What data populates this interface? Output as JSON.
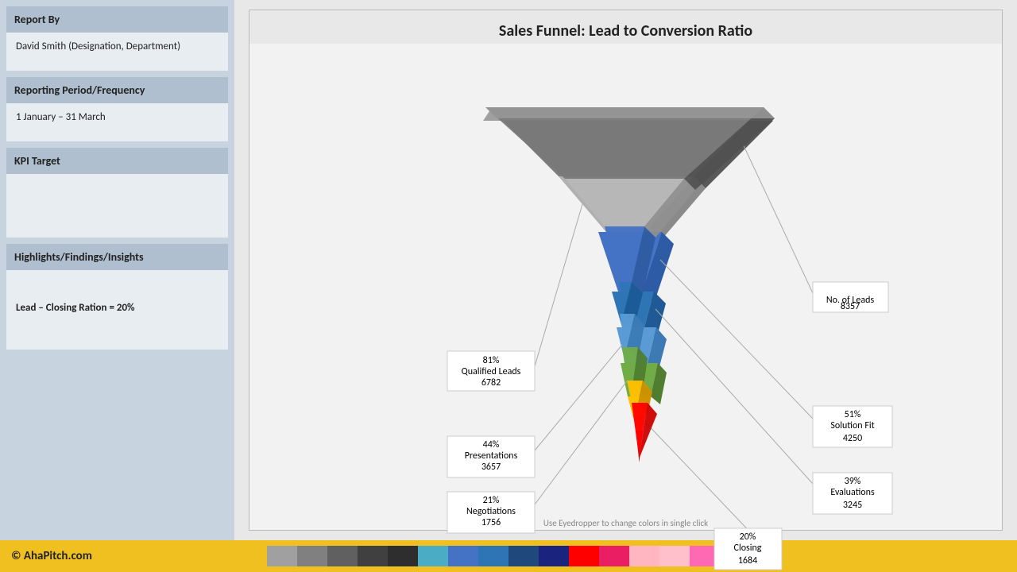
{
  "sidebar": {
    "report_by_label": "Report By",
    "report_by_value": "David Smith (Designation, Department)",
    "period_label": "Reporting Period/Frequency",
    "period_value": "1 January – 31 March",
    "kpi_label": "KPI Target",
    "kpi_value": "",
    "insights_label": "Highlights/Findings/Insights",
    "insights_value": "Lead – Closing Ration = 20%"
  },
  "chart": {
    "title": "Sales Funnel: Lead to Conversion Ratio",
    "eyedropper": "Use Eyedropper to change colors in single click",
    "funnel_stages": [
      {
        "label": "No. of Leads",
        "value": 8357,
        "pct": null,
        "color": "#808080",
        "side": "right"
      },
      {
        "label": "Qualified Leads",
        "value": 6782,
        "pct": "81%",
        "color": "#a0a0a0",
        "side": "left"
      },
      {
        "label": "Solution Fit",
        "value": 4250,
        "pct": "51%",
        "color": "#4472c4",
        "side": "right"
      },
      {
        "label": "Evaluations",
        "value": 3245,
        "pct": "39%",
        "color": "#2e75b6",
        "side": "right"
      },
      {
        "label": "Presentations",
        "value": 3657,
        "pct": "44%",
        "color": "#5b9bd5",
        "side": "left"
      },
      {
        "label": "Negotiations",
        "value": 1756,
        "pct": "21%",
        "color": "#70ad47",
        "side": "left"
      },
      {
        "label": "Closing",
        "value": 1684,
        "pct": "20%",
        "color": "#ff0000",
        "side": "right"
      }
    ]
  },
  "footer": {
    "copyright": "© AhaPitch.com"
  },
  "swatches": [
    "#a0a0a0",
    "#808080",
    "#606060",
    "#404040",
    "#2e2e2e",
    "#4bacc6",
    "#4472c4",
    "#2e75b6",
    "#1f497d",
    "#1a237e",
    "#ff0000",
    "#e91e63",
    "#ffb6c1",
    "#ffc0cb",
    "#ff69b4"
  ]
}
